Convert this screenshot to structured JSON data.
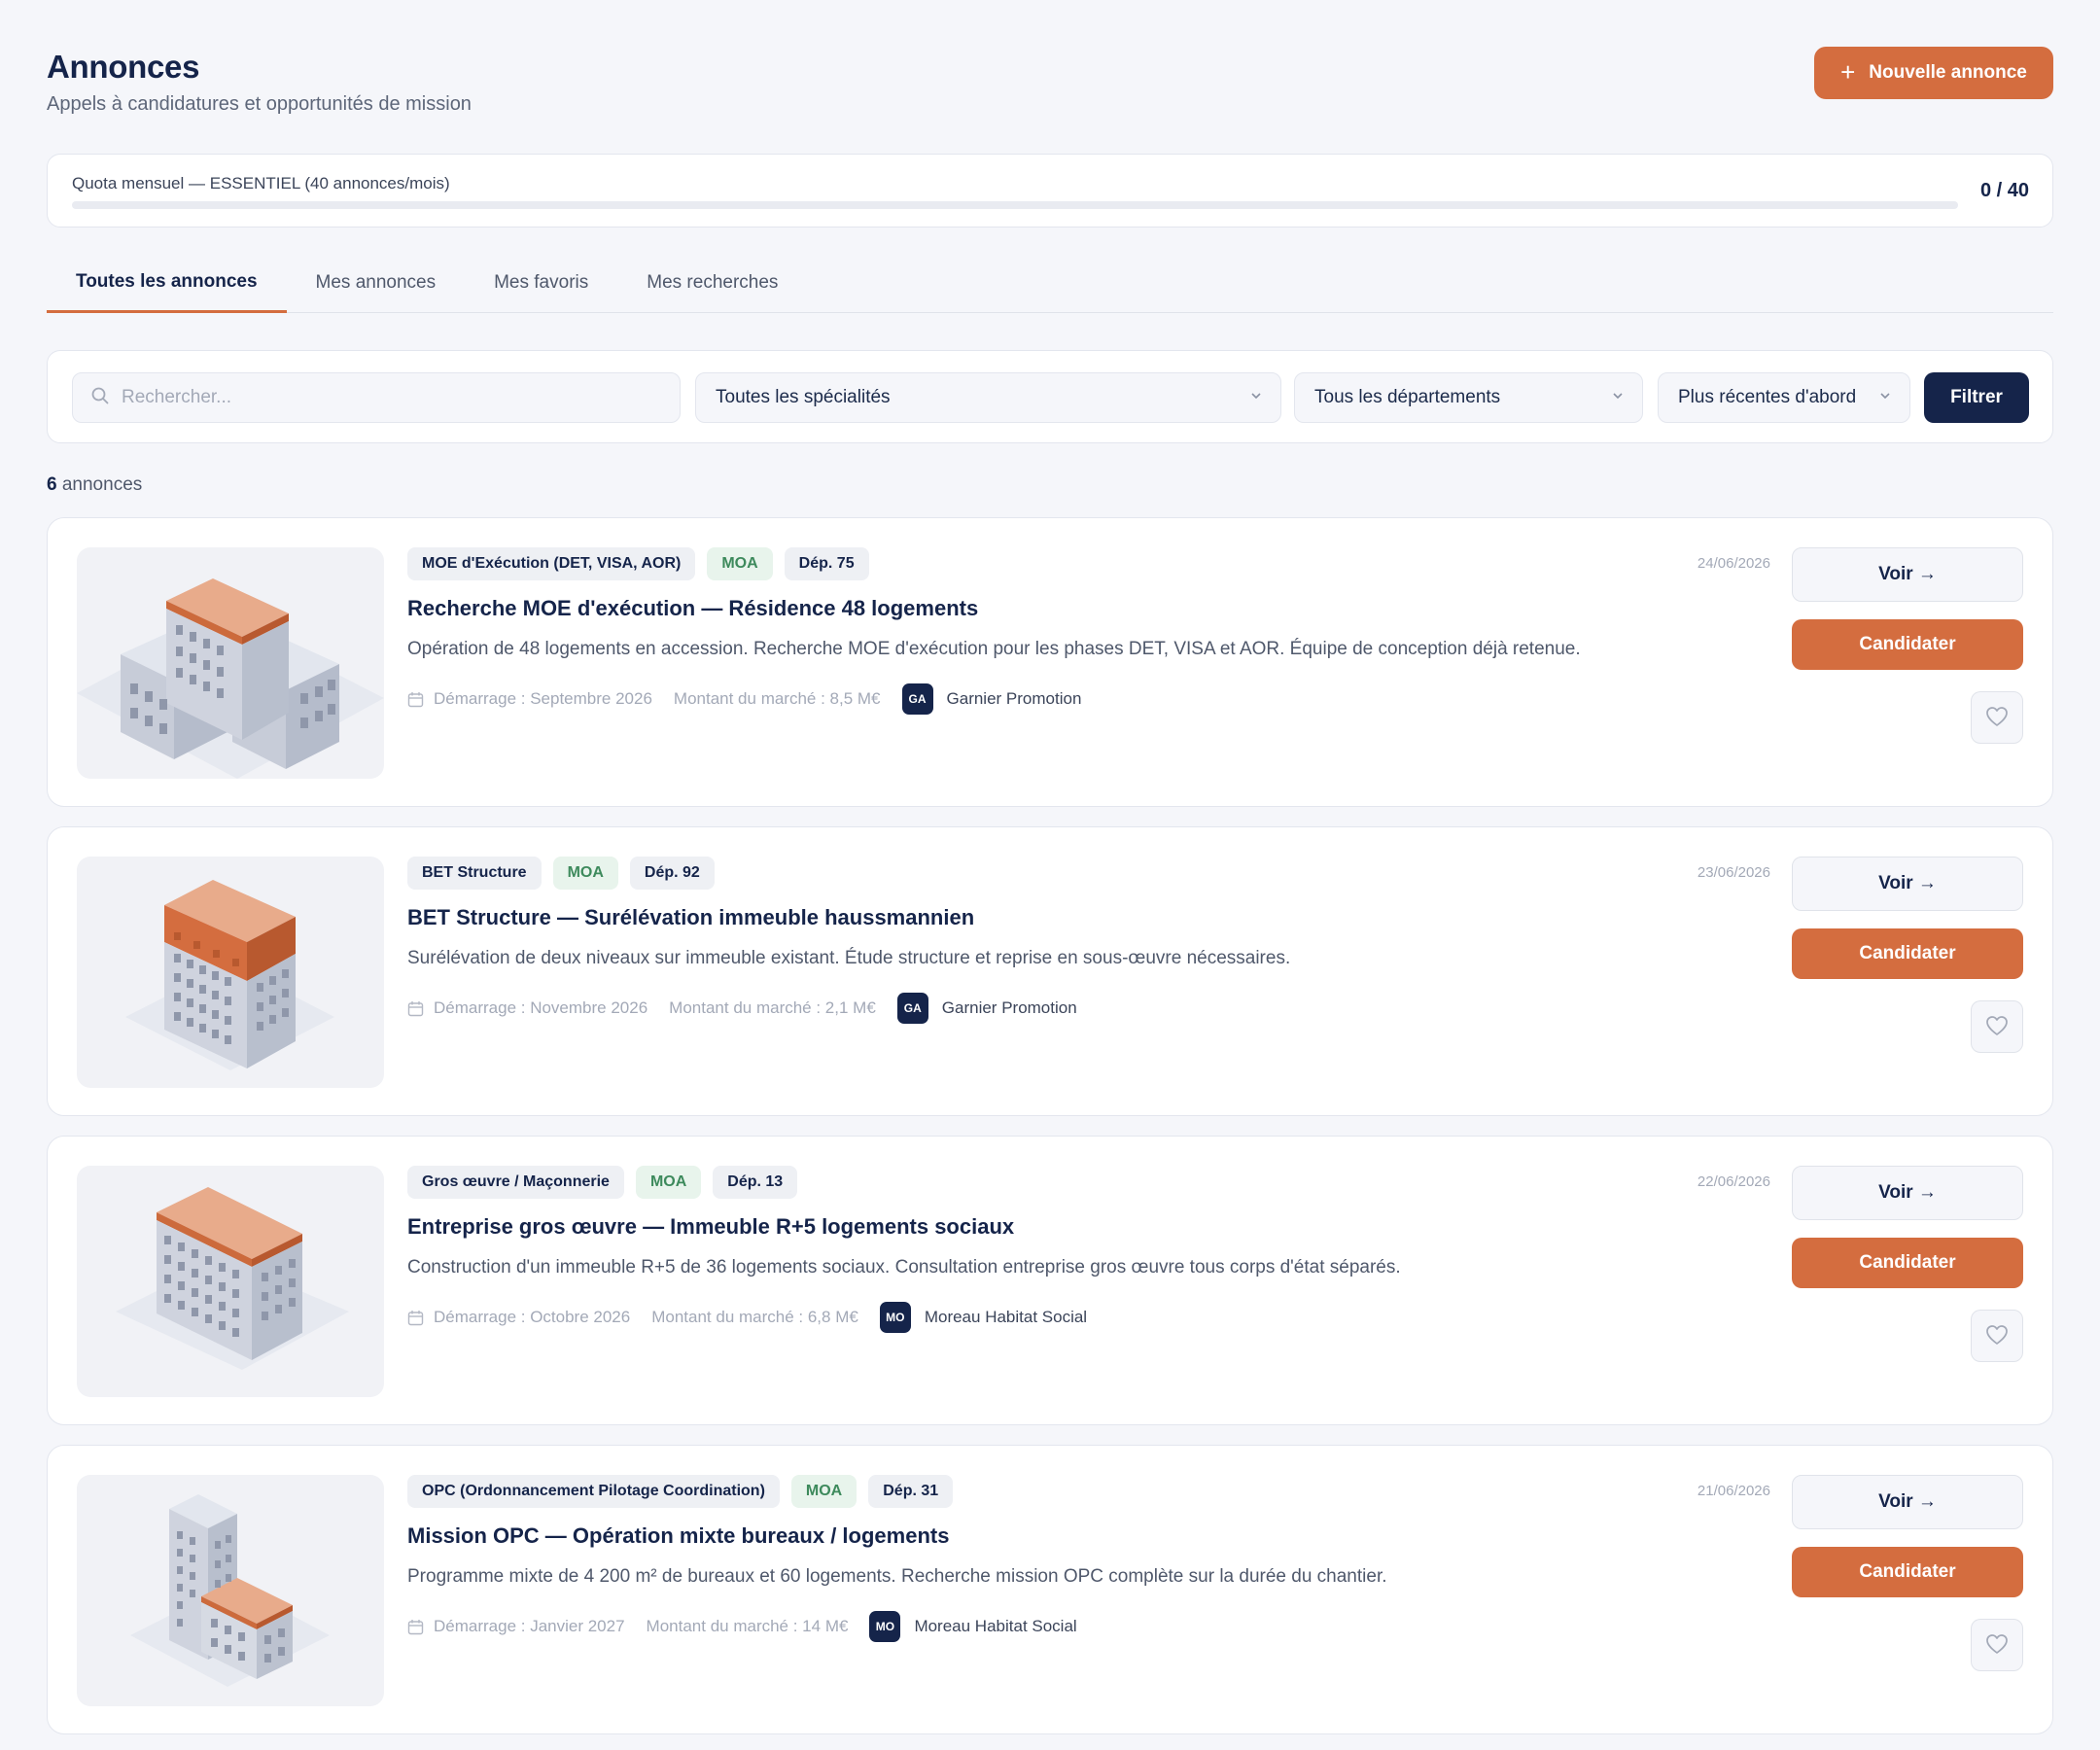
{
  "header": {
    "title": "Annonces",
    "subtitle": "Appels à candidatures et opportunités de mission",
    "new_button_label": "Nouvelle annonce"
  },
  "quota": {
    "label": "Quota mensuel — ESSENTIEL (40 annonces/mois)",
    "count": "0 / 40",
    "used_fraction": 0
  },
  "tabs": [
    {
      "label": "Toutes les annonces",
      "active": true
    },
    {
      "label": "Mes annonces",
      "active": false
    },
    {
      "label": "Mes favoris",
      "active": false
    },
    {
      "label": "Mes recherches",
      "active": false
    }
  ],
  "filters": {
    "search_placeholder": "Rechercher...",
    "specialty": "Toutes les spécialités",
    "department": "Tous les départements",
    "sort": "Plus récentes d'abord",
    "filter_button": "Filtrer"
  },
  "results": {
    "count": "6",
    "suffix": "annonces"
  },
  "actions": {
    "view_label": "Voir →",
    "apply_label": "Candidater"
  },
  "colors": {
    "accent": "#d46d3f",
    "navy": "#15244a",
    "moa_green": "#3d8a5c"
  },
  "listings": [
    {
      "tags": [
        "MOE d'Exécution (DET, VISA, AOR)",
        "MOA",
        "Dép. 75"
      ],
      "title": "Recherche MOE d'exécution — Résidence 48 logements",
      "description": "Opération de 48 logements en accession. Recherche MOE d'exécution pour les phases DET, VISA et AOR. Équipe de conception déjà retenue.",
      "start": "Démarrage : Septembre 2026",
      "amount": "Montant du marché : 8,5 M€",
      "avatar": "GA",
      "company": "Garnier Promotion",
      "date": "24/06/2026"
    },
    {
      "tags": [
        "BET Structure",
        "MOA",
        "Dép. 92"
      ],
      "title": "BET Structure — Surélévation immeuble haussmannien",
      "description": "Surélévation de deux niveaux sur immeuble existant. Étude structure et reprise en sous-œuvre nécessaires.",
      "start": "Démarrage : Novembre 2026",
      "amount": "Montant du marché : 2,1 M€",
      "avatar": "GA",
      "company": "Garnier Promotion",
      "date": "23/06/2026"
    },
    {
      "tags": [
        "Gros œuvre / Maçonnerie",
        "MOA",
        "Dép. 13"
      ],
      "title": "Entreprise gros œuvre — Immeuble R+5 logements sociaux",
      "description": "Construction d'un immeuble R+5 de 36 logements sociaux. Consultation entreprise gros œuvre tous corps d'état séparés.",
      "start": "Démarrage : Octobre 2026",
      "amount": "Montant du marché : 6,8 M€",
      "avatar": "MO",
      "company": "Moreau Habitat Social",
      "date": "22/06/2026"
    },
    {
      "tags": [
        "OPC (Ordonnancement Pilotage Coordination)",
        "MOA",
        "Dép. 31"
      ],
      "title": "Mission OPC — Opération mixte bureaux / logements",
      "description": "Programme mixte de 4 200 m² de bureaux et 60 logements. Recherche mission OPC complète sur la durée du chantier.",
      "start": "Démarrage : Janvier 2027",
      "amount": "Montant du marché : 14 M€",
      "avatar": "MO",
      "company": "Moreau Habitat Social",
      "date": "21/06/2026"
    }
  ]
}
